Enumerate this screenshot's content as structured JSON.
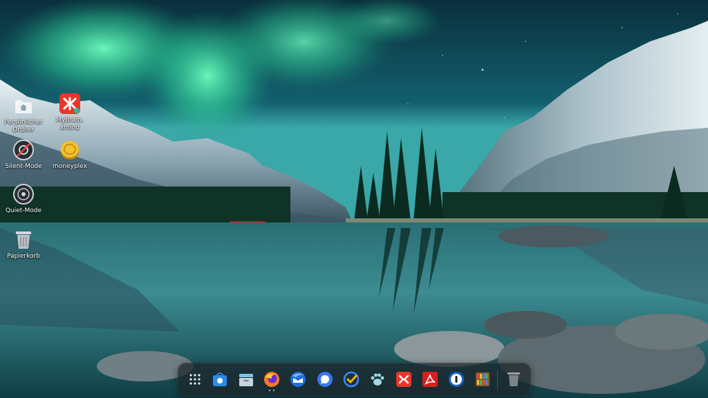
{
  "desktop": {
    "icons": [
      {
        "label_line1": "Persönlicher",
        "label_line2": "Ordner",
        "icon": "home-folder-icon"
      },
      {
        "label_line1": "MyBrain.",
        "label_line2": "xmind",
        "icon": "xmind-icon"
      },
      {
        "label_line1": "Silent-Mode",
        "label_line2": "",
        "icon": "speaker-muted-icon"
      },
      {
        "label_line1": "moneyplex",
        "label_line2": "",
        "icon": "moneyplex-coin-icon"
      },
      {
        "label_line1": "Quiet-Mode",
        "label_line2": "",
        "icon": "speaker-quiet-icon"
      },
      {
        "label_line1": "Papierkorb",
        "label_line2": "",
        "icon": "trash-icon"
      }
    ]
  },
  "dock": {
    "items": [
      {
        "name": "app-launcher",
        "icon": "grid-icon"
      },
      {
        "name": "app-store",
        "icon": "store-bag-icon"
      },
      {
        "name": "file-manager",
        "icon": "folder-icon"
      },
      {
        "name": "firefox",
        "icon": "firefox-icon",
        "running": true
      },
      {
        "name": "thunderbird",
        "icon": "thunderbird-icon"
      },
      {
        "name": "signal",
        "icon": "chat-bubble-icon"
      },
      {
        "name": "tasks",
        "icon": "checkmark-circle-icon"
      },
      {
        "name": "paw-app",
        "icon": "paw-icon"
      },
      {
        "name": "xmind",
        "icon": "xmind-icon"
      },
      {
        "name": "pdf-reader",
        "icon": "pdf-icon"
      },
      {
        "name": "1password",
        "icon": "password-keyhole-icon"
      },
      {
        "name": "library",
        "icon": "bookshelf-icon"
      },
      {
        "name": "trash",
        "icon": "trash-icon"
      }
    ]
  },
  "colors": {
    "aurora": "#3ef0a8",
    "sky": "#0f4f63",
    "water": "#1f6c78",
    "dock_bg": "#1c242a"
  }
}
